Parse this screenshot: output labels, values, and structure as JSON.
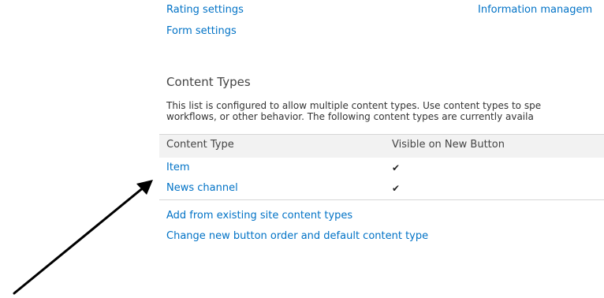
{
  "settings_links": {
    "rating_settings": "Rating settings",
    "form_settings": "Form settings",
    "information_management": "Information managem"
  },
  "content_types": {
    "title": "Content Types",
    "description_line1": "This list is configured to allow multiple content types. Use content types to spe",
    "description_line2": "workflows, or other behavior. The following content types are currently availa",
    "columns": {
      "content_type": "Content Type",
      "visible_on_new_button": "Visible on New Button"
    },
    "rows": [
      {
        "name": "Item",
        "visible": "✔"
      },
      {
        "name": "News channel",
        "visible": "✔"
      }
    ],
    "actions": {
      "add_existing": "Add from existing site content types",
      "change_order": "Change new button order and default content type"
    }
  },
  "annotation": {
    "arrow_color": "#000000"
  }
}
